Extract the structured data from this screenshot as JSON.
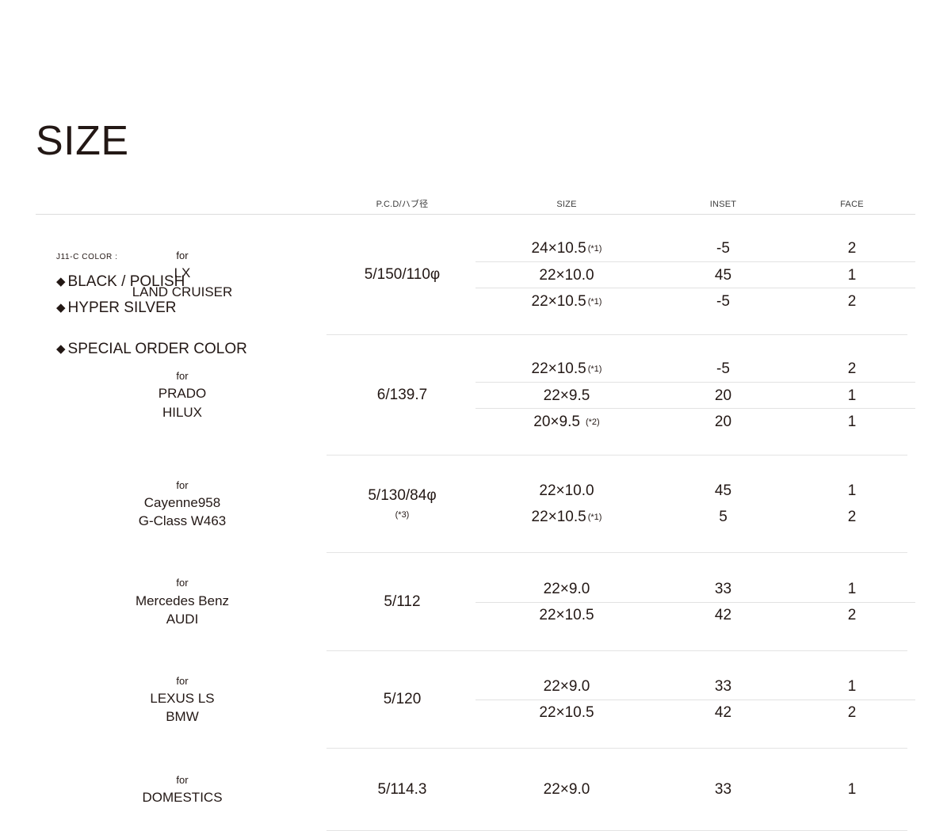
{
  "page": {
    "title": "SIZE"
  },
  "color_legend": {
    "title": "J11-C COLOR :",
    "diamond_icon": "◆",
    "items": [
      {
        "label": "BLACK / POLISH"
      },
      {
        "label": "HYPER SILVER"
      },
      {
        "label": "SPECIAL ORDER COLOR"
      }
    ]
  },
  "table": {
    "headers": {
      "vehicle": "",
      "pcd": "P.C.D/ハブ径",
      "size": "SIZE",
      "inset": "INSET",
      "face": "FACE"
    },
    "groups": [
      {
        "for_label": "for",
        "vehicles": [
          "LX",
          "LAND CRUISER"
        ],
        "pcd": "5/150/110φ",
        "pcd_note": "",
        "rows": [
          {
            "size": "24×10.5",
            "note": "(*1)",
            "note_wide": false,
            "inset": "-5",
            "face": "2",
            "separator": false
          },
          {
            "size": "22×10.0",
            "note": "",
            "note_wide": false,
            "inset": "45",
            "face": "1",
            "separator": true
          },
          {
            "size": "22×10.5",
            "note": "(*1)",
            "note_wide": false,
            "inset": "-5",
            "face": "2",
            "separator": true
          }
        ]
      },
      {
        "for_label": "for",
        "vehicles": [
          "PRADO",
          "HILUX"
        ],
        "pcd": "6/139.7",
        "pcd_note": "",
        "rows": [
          {
            "size": "22×10.5",
            "note": "(*1)",
            "note_wide": false,
            "inset": "-5",
            "face": "2",
            "separator": false
          },
          {
            "size": "22×9.5",
            "note": "",
            "note_wide": false,
            "inset": "20",
            "face": "1",
            "separator": true
          },
          {
            "size": "20×9.5",
            "note": "(*2)",
            "note_wide": true,
            "inset": "20",
            "face": "1",
            "separator": true
          }
        ]
      },
      {
        "for_label": "for",
        "vehicles": [
          "Cayenne958",
          "G-Class W463"
        ],
        "pcd": "5/130/84φ",
        "pcd_note": "(*3)",
        "rows": [
          {
            "size": "22×10.0",
            "note": "",
            "note_wide": false,
            "inset": "45",
            "face": "1",
            "separator": false
          },
          {
            "size": "22×10.5",
            "note": "(*1)",
            "note_wide": false,
            "inset": "5",
            "face": "2",
            "separator": false
          }
        ]
      },
      {
        "for_label": "for",
        "vehicles": [
          "Mercedes Benz",
          "AUDI"
        ],
        "pcd": "5/112",
        "pcd_note": "",
        "rows": [
          {
            "size": "22×9.0",
            "note": "",
            "note_wide": false,
            "inset": "33",
            "face": "1",
            "separator": false
          },
          {
            "size": "22×10.5",
            "note": "",
            "note_wide": false,
            "inset": "42",
            "face": "2",
            "separator": true
          }
        ]
      },
      {
        "for_label": "for",
        "vehicles": [
          "LEXUS LS",
          "BMW"
        ],
        "pcd": "5/120",
        "pcd_note": "",
        "rows": [
          {
            "size": "22×9.0",
            "note": "",
            "note_wide": false,
            "inset": "33",
            "face": "1",
            "separator": false
          },
          {
            "size": "22×10.5",
            "note": "",
            "note_wide": false,
            "inset": "42",
            "face": "2",
            "separator": true
          }
        ]
      },
      {
        "for_label": "for",
        "vehicles": [
          "DOMESTICS"
        ],
        "pcd": "5/114.3",
        "pcd_note": "",
        "rows": [
          {
            "size": "22×9.0",
            "note": "",
            "note_wide": false,
            "inset": "33",
            "face": "1",
            "separator": false
          }
        ]
      }
    ]
  },
  "colors": {
    "text": "#231815",
    "rule": "#dcdcdc",
    "rule_light": "#e4e4e4",
    "background": "#ffffff"
  }
}
